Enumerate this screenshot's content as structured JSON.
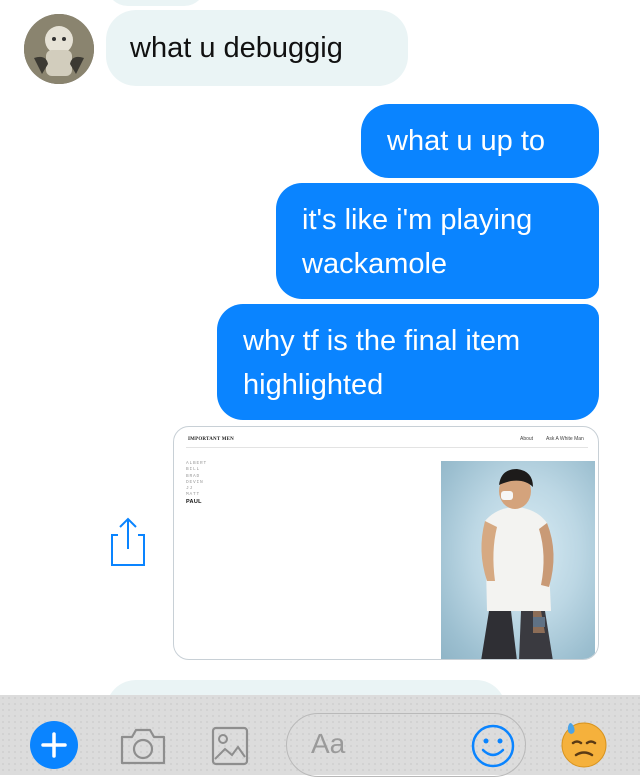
{
  "conversation": {
    "messages": [
      {
        "direction": "incoming",
        "text": "what u debuggig"
      },
      {
        "direction": "outgoing",
        "text": "what u up to"
      },
      {
        "direction": "outgoing",
        "lines": [
          "it's like i'm playing",
          "wackamole"
        ]
      },
      {
        "direction": "outgoing",
        "lines": [
          "why tf is the final item",
          "highlighted"
        ]
      }
    ],
    "link_preview": {
      "site_brand": "IMPORTANT MEN",
      "nav": [
        "About",
        "Ask A White Man"
      ],
      "names": [
        "ALBERT",
        "BILL",
        "BRAD",
        "DEVIN",
        "JJ",
        "MATT",
        "PAUL"
      ],
      "highlighted_name": "PAUL"
    }
  },
  "composer": {
    "input_placeholder": "Aa"
  },
  "colors": {
    "outgoing_bubble": "#0a84ff",
    "incoming_bubble": "#eaf4f5",
    "accent": "#0a84ff"
  },
  "icons": [
    "share-icon",
    "plus-icon",
    "camera-icon",
    "gallery-icon",
    "smiley-icon",
    "sweat-emoji-icon"
  ]
}
